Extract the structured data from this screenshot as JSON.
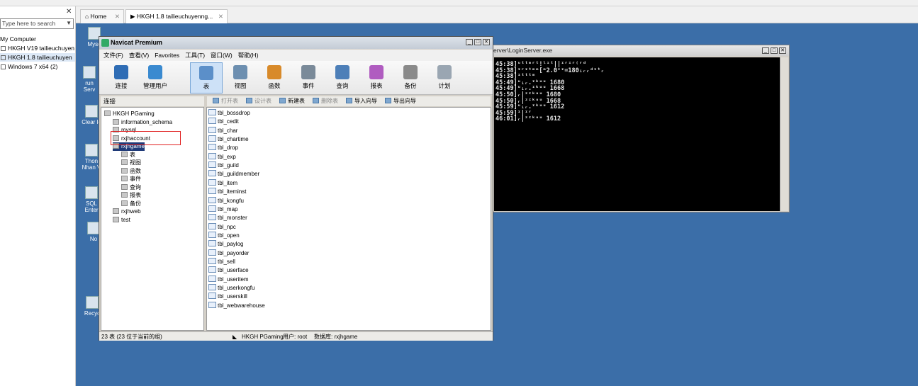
{
  "library": {
    "search_placeholder": "Type here to search",
    "root": "My Computer",
    "items": [
      {
        "label": "HKGH V19 tailieuchuyen"
      },
      {
        "label": "HKGH 1.8 tailieuchuyen"
      },
      {
        "label": "Windows 7 x64 (2)"
      }
    ]
  },
  "tabs": [
    {
      "label": "Home"
    },
    {
      "label": "HKGH 1.8 tailieuchuyenng..."
    }
  ],
  "desktop_icons": [
    {
      "label": "Mysq"
    },
    {
      "label": "run Serv"
    },
    {
      "label": "Clear lo"
    },
    {
      "label": "Thon Nhan V"
    },
    {
      "label": "SQL Enter"
    },
    {
      "label": "No"
    },
    {
      "label": "Recyc"
    }
  ],
  "console": {
    "title": "erver\\LoginServer.exe",
    "lines": [
      "45:38]ᵘᵗᵗᵐʳᵗ!ˡᶦᵗ||ᶦʳᶦʳ⁽ʳᵈ",
      "45:38]ᶦʳᶦᵗᵐᵐ[ᵐ2.0ᶦᶦ=180ᵢᵣᵣᵈᶦᵗᵣ",
      "45:38]ᶦᵗᵗᵗᵐ",
      "45:49]ᵘᵢᵣ.ᶦᵏᵘᵘ 1680",
      "45:49]ᵘᵢᵣ.ᶦᵏᵘᵘ 1668",
      "45:50]ᵣ|ᶻᶦᵏᵘᵘ 1680",
      "45:50]ᵣ|ᶻᶦᵏᵘᵘ 1668",
      "45:59]ᵘᵢᵣ.ᶦᵏᵘᵘ 1612",
      "45:59]ᶦ|ᶦʳ",
      "46:01]ᵣ|ᶻᶦᵏᵘᵘ 1612"
    ]
  },
  "navicat": {
    "title": "Navicat Premium",
    "menu": [
      "文件(F)",
      "查看(V)",
      "Favorites",
      "工具(T)",
      "窗口(W)",
      "帮助(H)"
    ],
    "toolbar": [
      {
        "label": "连接",
        "color": "#2f6db5"
      },
      {
        "label": "管理用户",
        "color": "#3a8ad0"
      },
      {
        "label": "表",
        "color": "#5b8fc9"
      },
      {
        "label": "视图",
        "color": "#6d8fb0"
      },
      {
        "label": "函数",
        "color": "#d88a2a"
      },
      {
        "label": "事件",
        "color": "#7a8a99"
      },
      {
        "label": "查询",
        "color": "#4d7fb8"
      },
      {
        "label": "报表",
        "color": "#b05cc0"
      },
      {
        "label": "备份",
        "color": "#8a8a8a"
      },
      {
        "label": "计划",
        "color": "#9aa6b2"
      }
    ],
    "panel_header": "连接",
    "object_toolbar": [
      "打开表",
      "设计表",
      "新建表",
      "删除表",
      "导入向导",
      "导出向导"
    ],
    "tree": [
      {
        "label": "HKGH PGaming",
        "level": 0
      },
      {
        "label": "information_schema",
        "level": 1
      },
      {
        "label": "mysql",
        "level": 1
      },
      {
        "label": "rxjhaccount",
        "level": 1
      },
      {
        "label": "rxjhgame",
        "level": 1,
        "selected": true
      },
      {
        "label": "表",
        "level": 2
      },
      {
        "label": "视图",
        "level": 2
      },
      {
        "label": "函数",
        "level": 2
      },
      {
        "label": "事件",
        "level": 2
      },
      {
        "label": "查询",
        "level": 2
      },
      {
        "label": "报表",
        "level": 2
      },
      {
        "label": "备份",
        "level": 2
      },
      {
        "label": "rxjhweb",
        "level": 1
      },
      {
        "label": "test",
        "level": 1
      }
    ],
    "tables": [
      "tbl_bossdrop",
      "tbl_cedit",
      "tbl_char",
      "tbl_chartime",
      "tbl_drop",
      "tbl_exp",
      "tbl_guild",
      "tbl_guildmember",
      "tbl_item",
      "tbl_iteminst",
      "tbl_kongfu",
      "tbl_map",
      "tbl_monster",
      "tbl_npc",
      "tbl_open",
      "tbl_paylog",
      "tbl_payorder",
      "tbl_sell",
      "tbl_userface",
      "tbl_useritem",
      "tbl_userkongfu",
      "tbl_userskill",
      "tbl_webwarehouse"
    ],
    "status_left": "23 表 (23 位于当前的组)",
    "status_conn": "HKGH PGaming",
    "status_user": "用户: root",
    "status_db": "数据库: rxjhgame"
  }
}
